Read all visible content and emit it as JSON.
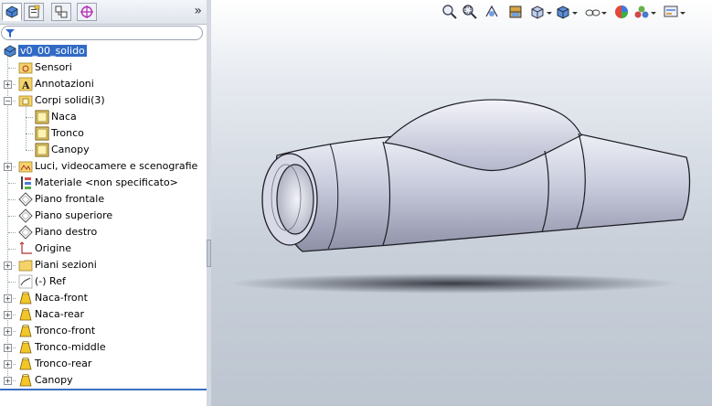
{
  "panel": {
    "tabs": [
      "feature-manager-icon",
      "property-manager-icon",
      "configuration-manager-icon",
      "dimxpert-icon"
    ],
    "expand_glyph": "»",
    "filter_icon": "filter-icon"
  },
  "tree": {
    "root": "v0_00_solido",
    "items": [
      {
        "label": "Sensori",
        "icon": "sensor-folder-icon",
        "expandable": false
      },
      {
        "label": "Annotazioni",
        "icon": "annotations-icon",
        "expandable": true
      },
      {
        "label": "Corpi solidi(3)",
        "icon": "solid-bodies-folder-icon",
        "expandable": true,
        "expanded": true
      },
      {
        "label": "Naca",
        "icon": "solid-body-icon",
        "child": true
      },
      {
        "label": "Tronco",
        "icon": "solid-body-icon",
        "child": true
      },
      {
        "label": "Canopy",
        "icon": "solid-body-icon",
        "child": true
      },
      {
        "label": "Luci, videocamere e scenografie",
        "icon": "lights-cameras-icon",
        "expandable": true
      },
      {
        "label": "Materiale <non specificato>",
        "icon": "material-icon",
        "expandable": false
      },
      {
        "label": "Piano frontale",
        "icon": "plane-icon",
        "expandable": false
      },
      {
        "label": "Piano superiore",
        "icon": "plane-icon",
        "expandable": false
      },
      {
        "label": "Piano destro",
        "icon": "plane-icon",
        "expandable": false
      },
      {
        "label": "Origine",
        "icon": "origin-icon",
        "expandable": false
      },
      {
        "label": "Piani sezioni",
        "icon": "folder-icon",
        "expandable": true
      },
      {
        "label": "(-) Ref",
        "icon": "sketch-icon",
        "expandable": false
      },
      {
        "label": "Naca-front",
        "icon": "loft-feature-icon",
        "expandable": true
      },
      {
        "label": "Naca-rear",
        "icon": "loft-feature-icon",
        "expandable": true
      },
      {
        "label": "Tronco-front",
        "icon": "loft-feature-icon",
        "expandable": true
      },
      {
        "label": "Tronco-middle",
        "icon": "loft-feature-icon",
        "expandable": true
      },
      {
        "label": "Tronco-rear",
        "icon": "loft-feature-icon",
        "expandable": true
      },
      {
        "label": "Canopy",
        "icon": "loft-feature-icon",
        "expandable": true
      }
    ]
  },
  "viewport": {
    "toolbar": [
      "zoom-to-fit-icon",
      "zoom-to-area-icon",
      "previous-view-icon",
      "section-view-icon",
      "view-orientation-icon",
      "display-style-icon",
      "hide-show-icon",
      "edit-appearance-icon",
      "apply-scene-icon",
      "view-settings-icon"
    ],
    "colors": {
      "background_top": "#ffffff",
      "background_bottom": "#bdc5d0",
      "body": "#c9ccdd",
      "selection": "#316ac5"
    }
  }
}
